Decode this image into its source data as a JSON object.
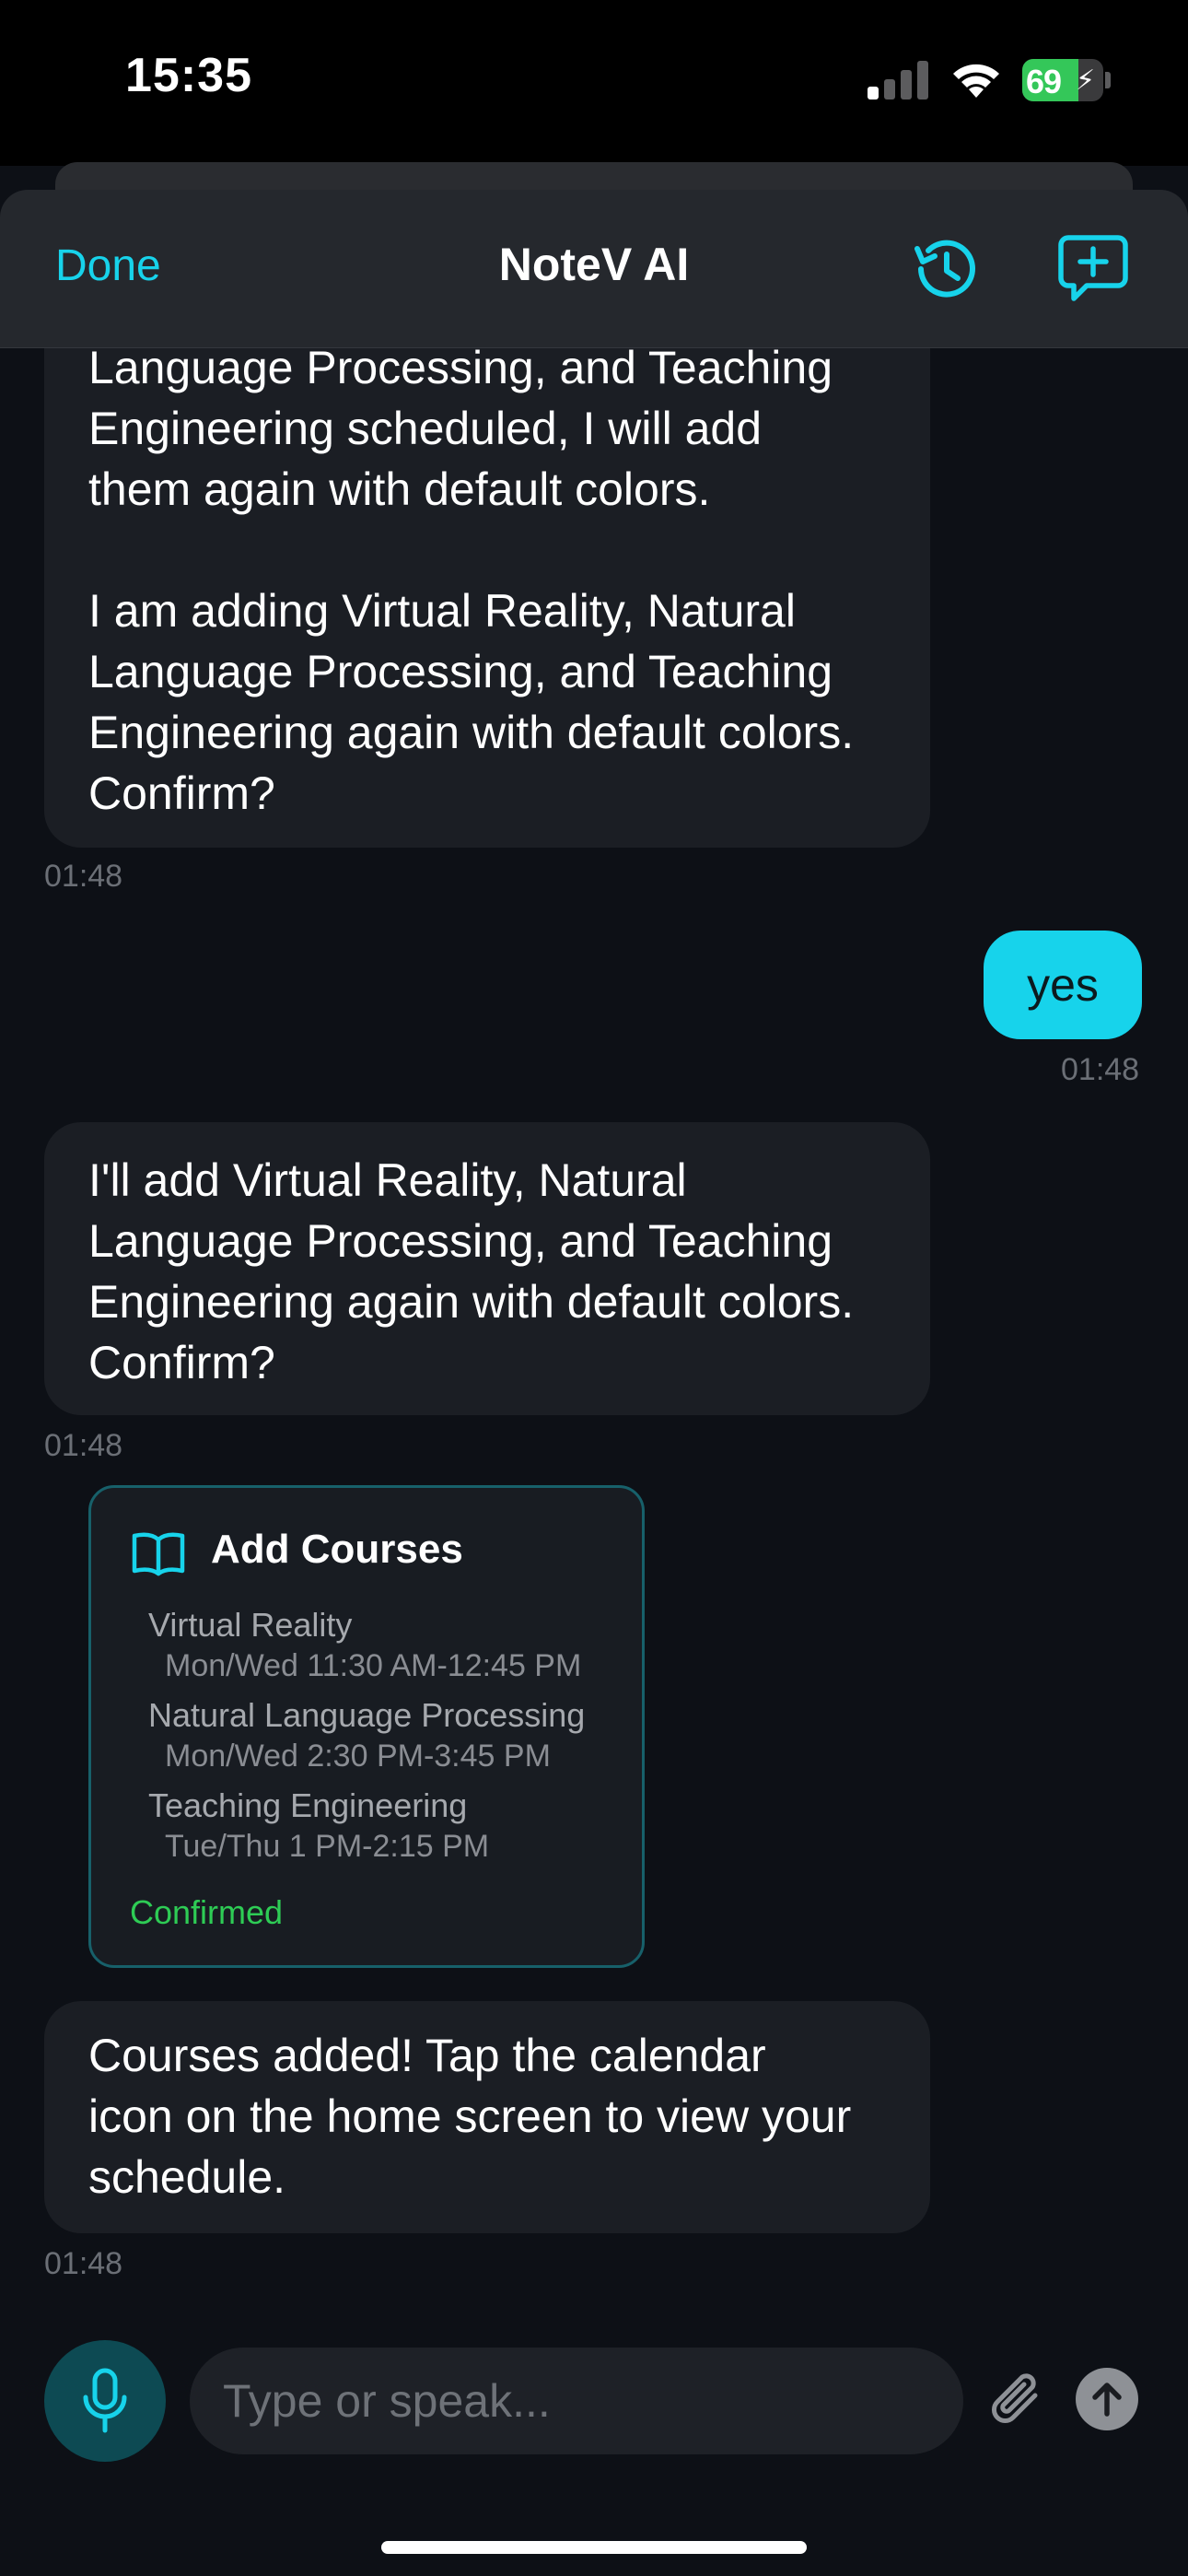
{
  "status_bar": {
    "time": "15:35",
    "battery": "69",
    "battery_level": 0.69
  },
  "nav": {
    "done_label": "Done",
    "title": "NoteV AI",
    "history_icon": "history-icon",
    "compose_icon": "new-chat-icon"
  },
  "messages": [
    {
      "role": "assistant",
      "text": "Language Processing, and Teaching\nEngineering scheduled, I will add\nthem again with default colors.\n\nI am adding Virtual Reality, Natural\nLanguage Processing, and Teaching\nEngineering again with default colors.\nConfirm?",
      "time": "01:48"
    },
    {
      "role": "user",
      "text": "yes",
      "time": "01:48"
    },
    {
      "role": "assistant",
      "text": "I'll add Virtual Reality, Natural\nLanguage Processing, and Teaching\nEngineering again with default colors.\nConfirm?",
      "time": "01:48"
    },
    {
      "role": "assistant",
      "text": "Courses added! Tap the calendar\nicon on the home screen to view your\nschedule.",
      "time": "01:48"
    }
  ],
  "card": {
    "icon": "book-icon",
    "title": "Add Courses",
    "courses": [
      {
        "name": "Virtual Reality",
        "schedule": "Mon/Wed 11:30 AM-12:45 PM"
      },
      {
        "name": "Natural Language Processing",
        "schedule": "Mon/Wed 2:30 PM-3:45 PM"
      },
      {
        "name": "Teaching Engineering",
        "schedule": "Tue/Thu 1 PM-2:15 PM"
      }
    ],
    "status": "Confirmed"
  },
  "composer": {
    "placeholder": "Type or speak...",
    "mic_icon": "microphone-icon",
    "attach_icon": "paperclip-icon",
    "send_icon": "send-arrow-icon"
  },
  "colors": {
    "accent": "#17d3eb",
    "background": "#0d1016",
    "bubble": "#1b1e24",
    "confirmed": "#2ecc55"
  }
}
